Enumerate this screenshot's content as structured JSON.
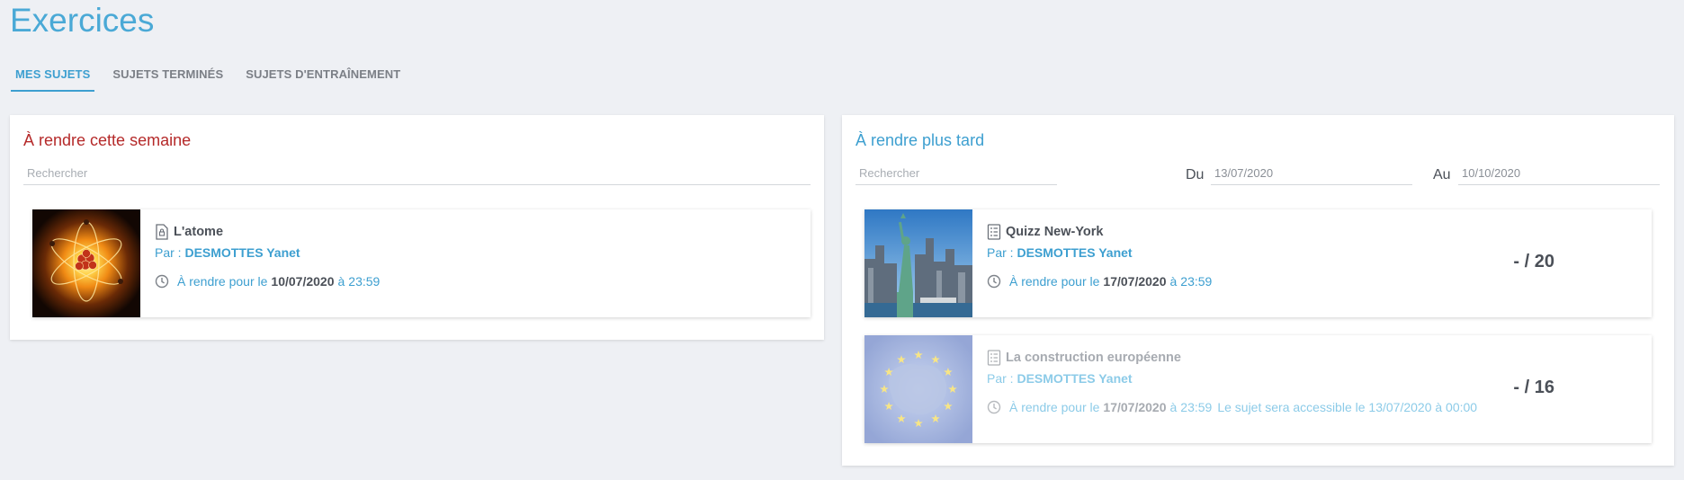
{
  "page": {
    "title": "Exercices"
  },
  "tabs": [
    {
      "label": "MES SUJETS",
      "active": true
    },
    {
      "label": "SUJETS TERMINÉS",
      "active": false
    },
    {
      "label": "SUJETS D'ENTRAÎNEMENT",
      "active": false
    }
  ],
  "this_week": {
    "title": "À rendre cette semaine",
    "search_placeholder": "Rechercher",
    "items": [
      {
        "title": "L'atome",
        "by_prefix": "Par :",
        "author": "DESMOTTES Yanet",
        "due_prefix": "À rendre pour le",
        "due_date": "10/07/2020",
        "due_at": "à",
        "due_time": "23:59",
        "thumbnail": "atom-image"
      }
    ]
  },
  "later": {
    "title": "À rendre plus tard",
    "search_placeholder": "Rechercher",
    "from_label": "Du",
    "from_value": "13/07/2020",
    "to_label": "Au",
    "to_value": "10/10/2020",
    "items": [
      {
        "title": "Quizz New-York",
        "by_prefix": "Par :",
        "author": "DESMOTTES Yanet",
        "due_prefix": "À rendre pour le",
        "due_date": "17/07/2020",
        "due_at": "à",
        "due_time": "23:59",
        "score": "- / 20",
        "thumbnail": "new-york-image"
      },
      {
        "title": "La construction européenne",
        "by_prefix": "Par :",
        "author": "DESMOTTES Yanet",
        "due_prefix": "À rendre pour le",
        "due_date": "17/07/2020",
        "due_at": "à",
        "due_time": "23:59",
        "note": "Le sujet sera accessible le 13/07/2020 à 00:00",
        "score": "- / 16",
        "thumbnail": "europe-flag-image"
      }
    ]
  },
  "colors": {
    "accent": "#3d9fd0",
    "urgent": "#b52a2a",
    "text": "#4b5058",
    "background": "#eef0f4"
  }
}
